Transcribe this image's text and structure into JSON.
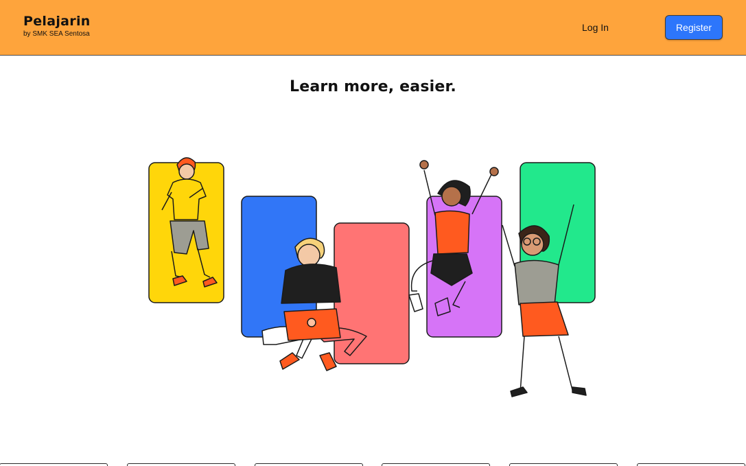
{
  "app": {
    "name": "Pelajarin",
    "subtitle": "by SMK SEA Sentosa"
  },
  "nav": {
    "login_label": "Log In",
    "register_label": "Register"
  },
  "hero": {
    "headline": "Learn more, easier.",
    "illustration": "students-celebrating-illustration"
  },
  "colors": {
    "navbar": "#fea43c",
    "register": "#2d76fb",
    "panel_yellow": "#ffd60a",
    "panel_blue": "#3176f7",
    "panel_red": "#ff7474",
    "panel_purple": "#d674f7",
    "panel_green": "#22e88c",
    "accent_orange": "#ff5a1f"
  }
}
